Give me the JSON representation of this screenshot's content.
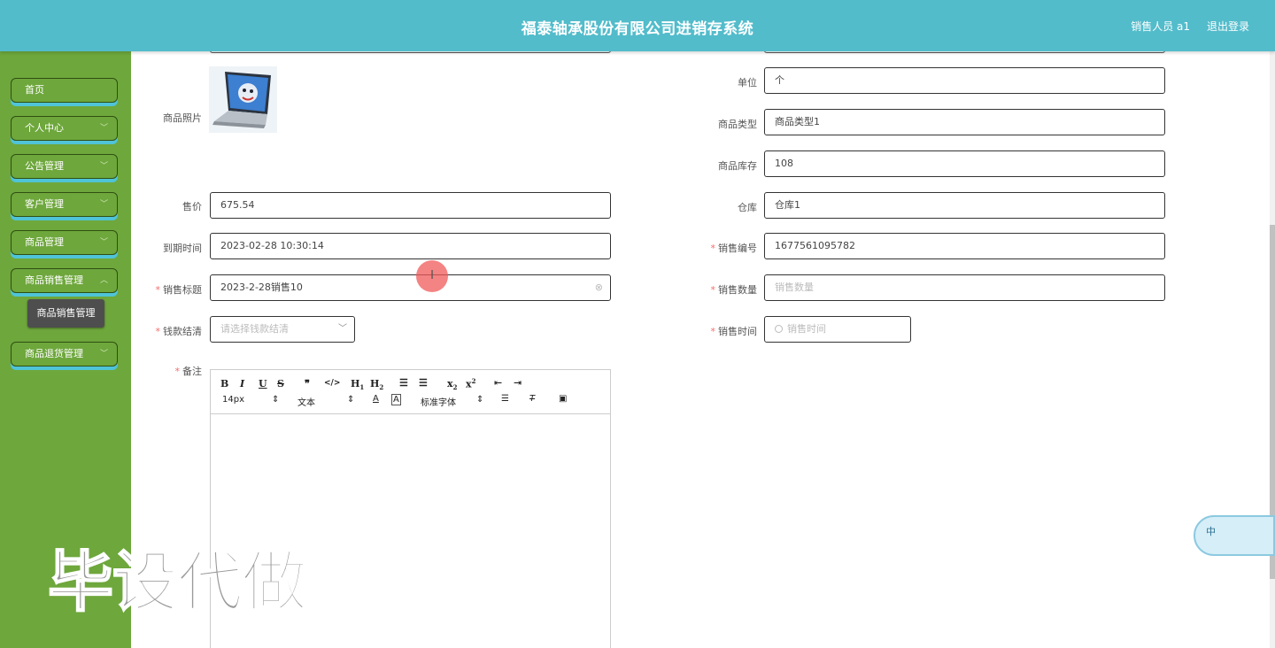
{
  "header": {
    "title": "福泰轴承股份有限公司进销存系统",
    "user": "销售人员 a1",
    "logout": "退出登录"
  },
  "sidebar": {
    "items": [
      {
        "label": "首页"
      },
      {
        "label": "个人中心"
      },
      {
        "label": "公告管理"
      },
      {
        "label": "客户管理"
      },
      {
        "label": "商品管理"
      },
      {
        "label": "商品销售管理"
      },
      {
        "label": "商品退货管理"
      }
    ],
    "submenu_label": "商品销售管理"
  },
  "form": {
    "photo_label": "商品照片",
    "price_label": "售价",
    "price": "675.54",
    "expire_label": "到期时间",
    "expire": "2023-02-28 10:30:14",
    "title_label": "销售标题",
    "title_value": "2023-2-28销售10",
    "settle_label": "钱款结清",
    "settle_placeholder": "请选择钱款结清",
    "remark_label": "备注",
    "unit_label": "单位",
    "unit": "个",
    "type_label": "商品类型",
    "type": "商品类型1",
    "stock_label": "商品库存",
    "stock": "108",
    "warehouse_label": "仓库",
    "warehouse": "仓库1",
    "sale_no_label": "销售编号",
    "sale_no": "1677561095782",
    "qty_label": "销售数量",
    "qty_placeholder": "销售数量",
    "time_label": "销售时间",
    "time_placeholder": "销售时间"
  },
  "editor": {
    "font_size": "14px",
    "text_style": "文本",
    "font_family": "标准字体"
  },
  "watermark": "毕设代做",
  "widget": {
    "label": "中"
  }
}
